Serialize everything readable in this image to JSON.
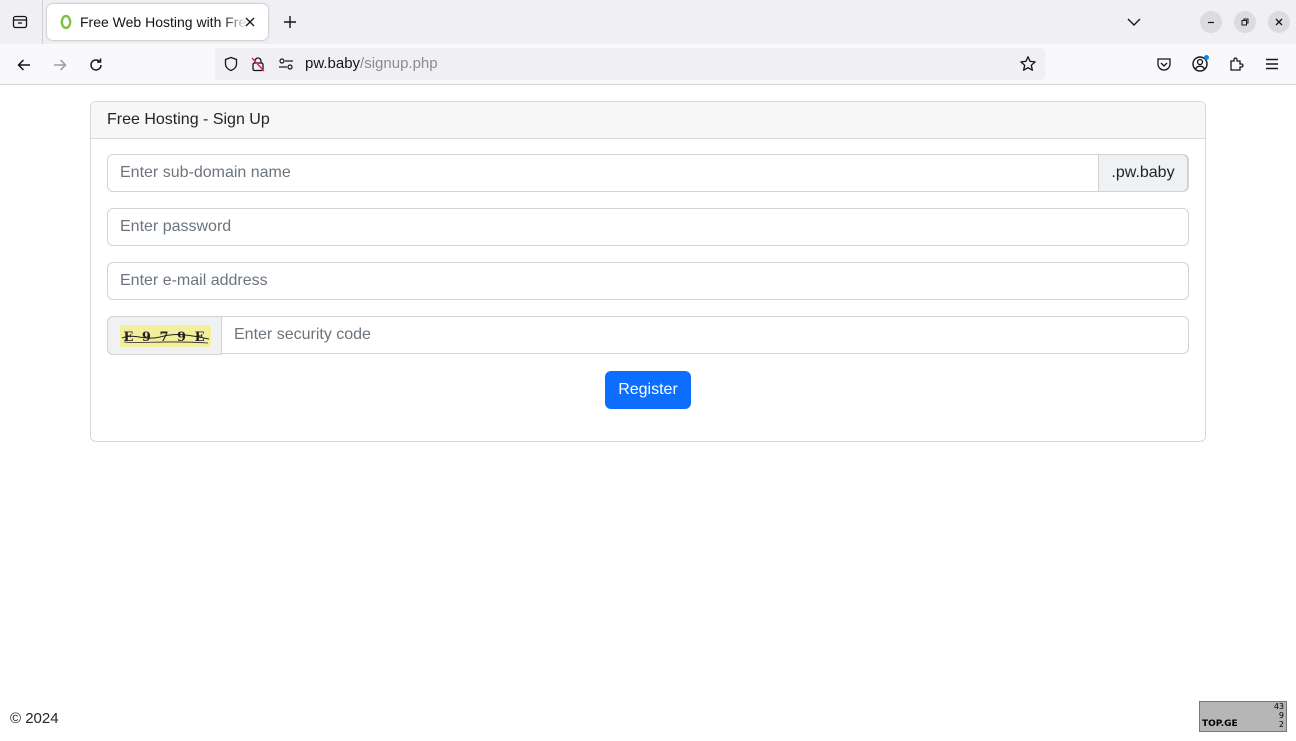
{
  "browser": {
    "tab_title": "Free Web Hosting with Free Subdomain",
    "url_host": "pw.baby",
    "url_path": "/signup.php"
  },
  "signup": {
    "header": "Free Hosting - Sign Up",
    "subdomain_placeholder": "Enter sub-domain name",
    "domain_suffix": ".pw.baby",
    "password_placeholder": "Enter password",
    "email_placeholder": "Enter e-mail address",
    "security_placeholder": "Enter security code",
    "captcha_text": "E 9 7 9 E",
    "register_label": "Register"
  },
  "footer": {
    "copyright": "© 2024"
  },
  "counter": {
    "label": "TOP.GE",
    "lines": [
      "43",
      "9",
      "2"
    ]
  },
  "colors": {
    "primary": "#0d6efd",
    "favicon": "#7cc243",
    "captcha_bg": "#f3ef9e"
  }
}
